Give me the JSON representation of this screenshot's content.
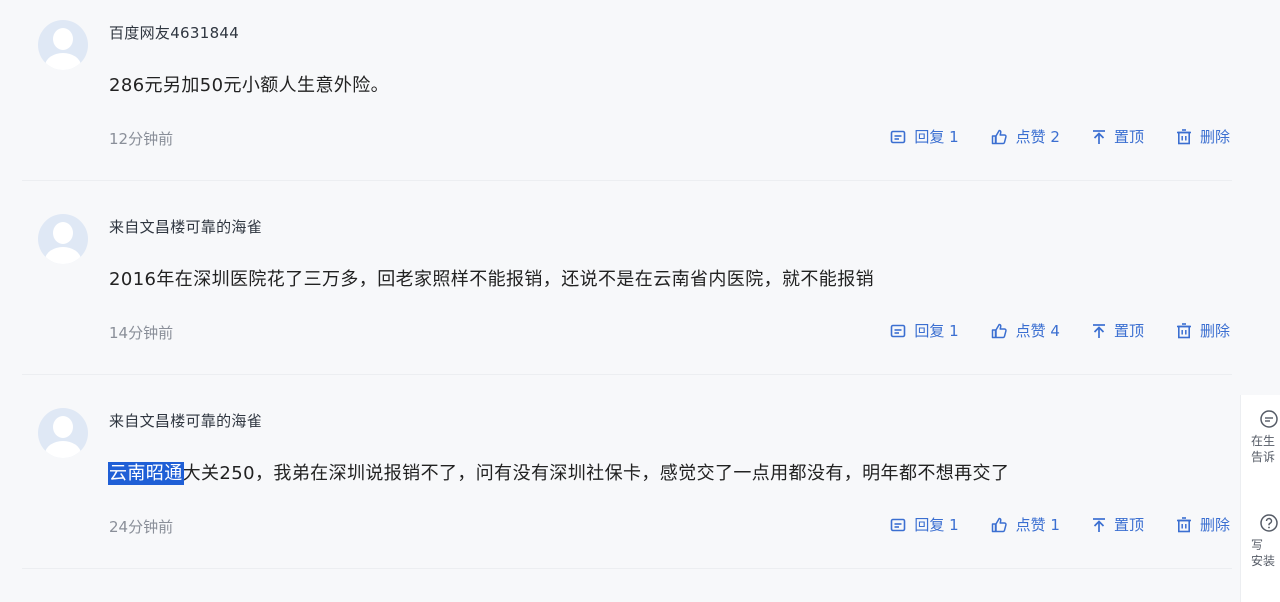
{
  "comments": [
    {
      "username": "百度网友4631844",
      "text": "286元另加50元小额人生意外险。",
      "time": "12分钟前",
      "reply": "回复 1",
      "like": "点赞 2",
      "pin": "置顶",
      "delete": "删除"
    },
    {
      "username": "来自文昌楼可靠的海雀",
      "text": "2016年在深圳医院花了三万多，回老家照样不能报销，还说不是在云南省内医院，就不能报销",
      "time": "14分钟前",
      "reply": "回复 1",
      "like": "点赞 4",
      "pin": "置顶",
      "delete": "删除"
    },
    {
      "username": "来自文昌楼可靠的海雀",
      "text_highlight": "云南昭通",
      "text": "大关250，我弟在深圳说报销不了，问有没有深圳社保卡，感觉交了一点用都没有，明年都不想再交了",
      "time": "24分钟前",
      "reply": "回复 1",
      "like": "点赞 1",
      "pin": "置顶",
      "delete": "删除"
    }
  ],
  "side_panel": {
    "items": [
      {
        "icon": "comment-icon",
        "lines": [
          "在生",
          "告诉"
        ]
      },
      {
        "icon": "help-icon",
        "lines": [
          "写",
          "安装"
        ]
      }
    ]
  },
  "colors": {
    "accent": "#3b6fd1",
    "highlight": "#1f5fd6",
    "avatar_bg": "#dfe8f5"
  }
}
